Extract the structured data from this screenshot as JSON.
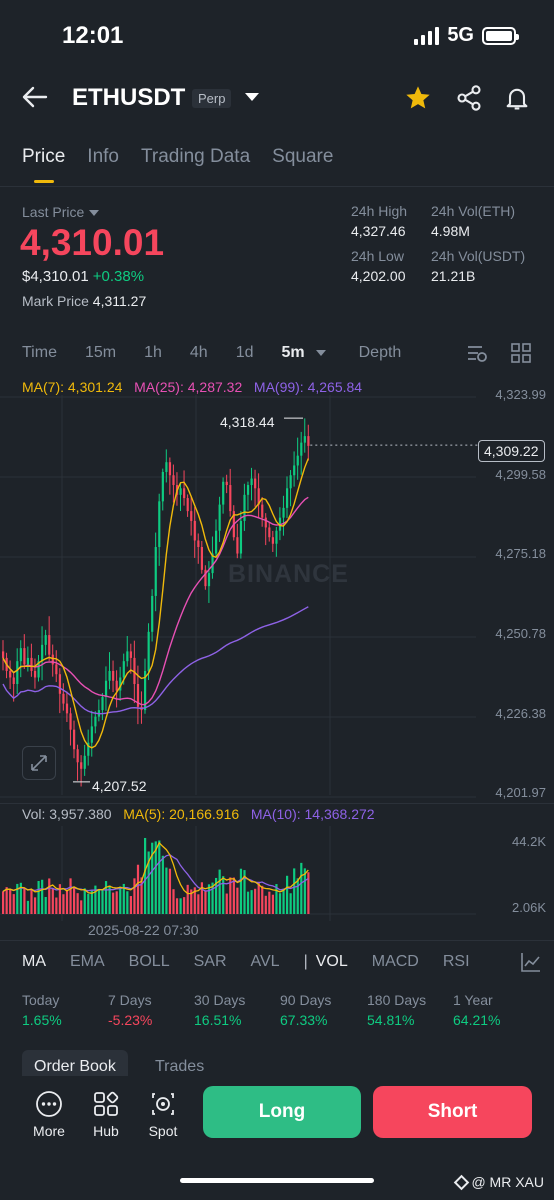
{
  "status": {
    "time": "12:01",
    "network": "5G"
  },
  "header": {
    "symbol": "ETHUSDT",
    "badge": "Perp"
  },
  "tabs": [
    "Price",
    "Info",
    "Trading Data",
    "Square"
  ],
  "price": {
    "last_label": "Last Price",
    "last": "4,310.01",
    "usd": "$4,310.01",
    "change": "+0.38%",
    "mark_label": "Mark Price",
    "mark": "4,311.27"
  },
  "stats": {
    "high_label": "24h High",
    "high": "4,327.46",
    "low_label": "24h Low",
    "low": "4,202.00",
    "vol_eth_label": "24h Vol(ETH)",
    "vol_eth": "4.98M",
    "vol_usdt_label": "24h Vol(USDT)",
    "vol_usdt": "21.21B"
  },
  "intervals": [
    "Time",
    "15m",
    "1h",
    "4h",
    "1d",
    "5m",
    "Depth"
  ],
  "ma": {
    "ma7": "MA(7): 4,301.24",
    "ma25": "MA(25): 4,287.32",
    "ma99": "MA(99): 4,265.84"
  },
  "colors": {
    "ma7": "#f0b90b",
    "ma25": "#e750b4",
    "ma99": "#8e62e6",
    "up": "#0ecb81",
    "down": "#f6465d"
  },
  "price_axis": [
    "4,323.99",
    "4,299.58",
    "4,275.18",
    "4,250.78",
    "4,226.38",
    "4,201.97"
  ],
  "current_tag": "4,309.22",
  "high_marker": "4,318.44",
  "low_marker": "4,207.52",
  "watermark": "BINANCE",
  "volume": {
    "vol": "Vol: 3,957.380",
    "ma5": "MA(5): 20,166.916",
    "ma10": "MA(10): 14,368.272",
    "axis_top": "44.2K",
    "axis_bottom": "2.06K"
  },
  "time_label": "2025-08-22 07:30",
  "indicator_tabs": [
    "MA",
    "EMA",
    "BOLL",
    "SAR",
    "AVL",
    "VOL",
    "MACD",
    "RSI"
  ],
  "performance": [
    {
      "label": "Today",
      "value": "1.65%"
    },
    {
      "label": "7 Days",
      "value": "-5.23%"
    },
    {
      "label": "30 Days",
      "value": "16.51%"
    },
    {
      "label": "90 Days",
      "value": "67.33%"
    },
    {
      "label": "180 Days",
      "value": "54.81%"
    },
    {
      "label": "1 Year",
      "value": "64.21%"
    }
  ],
  "book_tabs": {
    "order_book": "Order Book",
    "trades": "Trades"
  },
  "bottom": {
    "more": "More",
    "hub": "Hub",
    "spot": "Spot",
    "long": "Long",
    "short": "Short"
  },
  "credit": "@ MR XAU",
  "chart_data": {
    "type": "candlestick",
    "ylim": [
      4201.97,
      4323.99
    ],
    "closes": [
      4244,
      4240,
      4238,
      4236,
      4243,
      4247,
      4242,
      4244,
      4240,
      4238,
      4243,
      4248,
      4251,
      4245,
      4242,
      4239,
      4233,
      4230,
      4227,
      4222,
      4216,
      4212,
      4210,
      4214,
      4218,
      4223,
      4226,
      4228,
      4232,
      4237,
      4240,
      4237,
      4234,
      4238,
      4243,
      4246,
      4244,
      4236,
      4229,
      4228,
      4240,
      4252,
      4263,
      4278,
      4292,
      4301,
      4304,
      4300,
      4297,
      4294,
      4296,
      4293,
      4289,
      4286,
      4280,
      4278,
      4271,
      4266,
      4270,
      4276,
      4283,
      4291,
      4298,
      4297,
      4289,
      4281,
      4276,
      4286,
      4294,
      4297,
      4299,
      4296,
      4291,
      4287,
      4284,
      4281,
      4279,
      4283,
      4287,
      4290,
      4296,
      4300,
      4303,
      4306,
      4310,
      4312,
      4309
    ]
  }
}
